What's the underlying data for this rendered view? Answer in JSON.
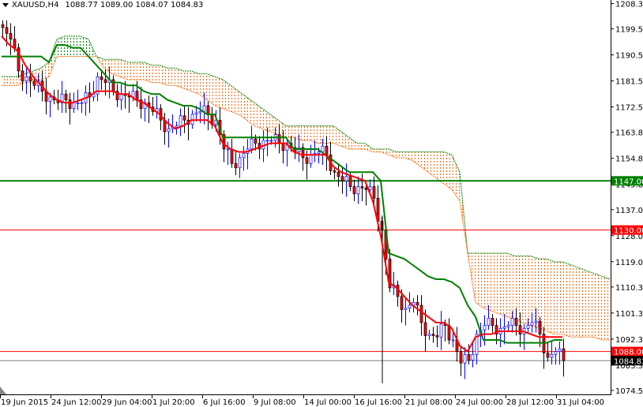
{
  "header": {
    "symbol": "XAUUSD,H4",
    "ohlc": "1088.77 1089.00 1084.07 1084.83"
  },
  "colors": {
    "bull_body": "#ffffff",
    "bull_line": "#0000ff",
    "bear_body": "#ff0000",
    "bear_line": "#000000",
    "tenkan": "#ff0000",
    "kijun": "#008000",
    "cloud_bear": "#ff6600",
    "cloud_bull": "#008000",
    "level_green": "#008000",
    "level_red": "#ff0000",
    "bid": "#808080"
  },
  "chart_data": {
    "type": "candlestick",
    "title": "XAUUSD,H4",
    "ylim": [
      1072.0,
      1209.5
    ],
    "y_ticks": [
      "1208.30",
      "1199.55",
      "1190.55",
      "1181.55",
      "1172.55",
      "1163.80",
      "1154.80",
      "1145.80",
      "1137.05",
      "1128.05",
      "1119.05",
      "1110.30",
      "1101.30",
      "1092.30",
      "1083.30",
      "1074.55"
    ],
    "x_ticks": [
      "19 Jun 2015",
      "24 Jun 12:00",
      "29 Jun 04:00",
      "1 Jul 20:00",
      "6 Jul 16:00",
      "9 Jul 08:00",
      "14 Jul 00:00",
      "16 Jul 16:00",
      "21 Jul 08:00",
      "24 Jul 00:00",
      "28 Jul 12:00",
      "31 Jul 04:00"
    ],
    "bars_total": 155,
    "closes_every_2_bars": [
      1200,
      1196,
      1185,
      1183,
      1180,
      1178,
      1176,
      1174,
      1175,
      1174,
      1174,
      1176,
      1183,
      1181,
      1178,
      1177,
      1176,
      1175,
      1174,
      1171,
      1168,
      1165,
      1166,
      1168,
      1170,
      1171,
      1170,
      1168,
      1158,
      1153,
      1155,
      1158,
      1160,
      1161,
      1161,
      1160,
      1160,
      1157,
      1155,
      1156,
      1157,
      1156,
      1150,
      1147,
      1145,
      1145,
      1144,
      1141,
      1130,
      1110,
      1107,
      1103,
      1105,
      1098,
      1094,
      1093,
      1097,
      1092,
      1084,
      1085,
      1094,
      1097,
      1097,
      1096,
      1097,
      1097,
      1096,
      1098,
      1094,
      1086,
      1088,
      1084.83
    ],
    "tenkan": [
      1197,
      1194,
      1192,
      1187,
      1183,
      1180,
      1177,
      1175,
      1174,
      1174,
      1175,
      1176,
      1178,
      1178,
      1178,
      1177,
      1177,
      1175,
      1174,
      1172,
      1170,
      1167,
      1165,
      1166,
      1168,
      1168,
      1168,
      1166,
      1160,
      1158,
      1157,
      1157,
      1158,
      1159,
      1160,
      1160,
      1160,
      1157,
      1156,
      1156,
      1156,
      1156,
      1152,
      1150,
      1149,
      1148,
      1147,
      1140,
      1128,
      1112,
      1110,
      1107,
      1104,
      1102,
      1100,
      1098,
      1098,
      1096,
      1090,
      1088,
      1093,
      1094,
      1094,
      1095,
      1095,
      1095,
      1095,
      1094,
      1093,
      1093,
      1093,
      1093
    ],
    "kijun": [
      1190,
      1190,
      1190,
      1190,
      1190,
      1190,
      1188,
      1194,
      1194,
      1193,
      1193,
      1190,
      1187,
      1184,
      1181,
      1181,
      1180,
      1180,
      1178,
      1177,
      1177,
      1175,
      1174,
      1173,
      1173,
      1172,
      1170,
      1170,
      1162,
      1162,
      1162,
      1162,
      1162,
      1162,
      1162,
      1162,
      1162,
      1158,
      1158,
      1158,
      1158,
      1156,
      1154,
      1152,
      1150,
      1150,
      1150,
      1150,
      1147,
      1122,
      1121,
      1120,
      1118,
      1116,
      1114,
      1113,
      1113,
      1112,
      1110,
      1104,
      1100,
      1092,
      1092,
      1092,
      1091,
      1091,
      1091,
      1091,
      1091,
      1091,
      1092,
      1092
    ],
    "cloud_span_a": [
      1183,
      1183,
      1183,
      1184,
      1185,
      1186,
      1188,
      1196,
      1197,
      1197,
      1197,
      1196,
      1190,
      1189,
      1189,
      1189,
      1188,
      1188,
      1188,
      1187,
      1187,
      1186,
      1186,
      1185,
      1185,
      1184,
      1184,
      1183,
      1182,
      1180,
      1178,
      1176,
      1174,
      1172,
      1170,
      1168,
      1166,
      1166,
      1166,
      1166,
      1166,
      1166,
      1166,
      1164,
      1162,
      1160,
      1160,
      1158,
      1158,
      1158,
      1157,
      1157,
      1157,
      1157,
      1157,
      1157,
      1157,
      1156,
      1150,
      1122,
      1122,
      1122,
      1122,
      1122,
      1122,
      1121,
      1121,
      1121,
      1120,
      1120,
      1119,
      1119,
      1118,
      1117,
      1116,
      1115,
      1114,
      1113
    ],
    "cloud_span_b": [
      1180,
      1180,
      1180,
      1181,
      1181,
      1182,
      1183,
      1190,
      1190,
      1190,
      1190,
      1190,
      1190,
      1186,
      1184,
      1183,
      1182,
      1182,
      1182,
      1181,
      1181,
      1180,
      1180,
      1179,
      1178,
      1177,
      1175,
      1173,
      1172,
      1171,
      1170,
      1168,
      1166,
      1165,
      1164,
      1163,
      1162,
      1162,
      1161,
      1161,
      1160,
      1160,
      1160,
      1159,
      1158,
      1158,
      1158,
      1157,
      1157,
      1156,
      1155,
      1155,
      1154,
      1152,
      1150,
      1148,
      1146,
      1144,
      1140,
      1122,
      1105,
      1103,
      1102,
      1101,
      1100,
      1099,
      1098,
      1097,
      1096,
      1095,
      1094,
      1094,
      1093,
      1093,
      1093,
      1093,
      1092,
      1092
    ],
    "levels": [
      {
        "price": 1147.0,
        "label": "1147.00",
        "color": "#008000"
      },
      {
        "price": 1130.0,
        "label": "1130.00",
        "color": "#ff0000"
      },
      {
        "price": 1088.0,
        "label": "1088.00",
        "color": "#ff0000"
      },
      {
        "price": 1084.83,
        "label": "1084.83",
        "color": "#000000"
      }
    ]
  }
}
